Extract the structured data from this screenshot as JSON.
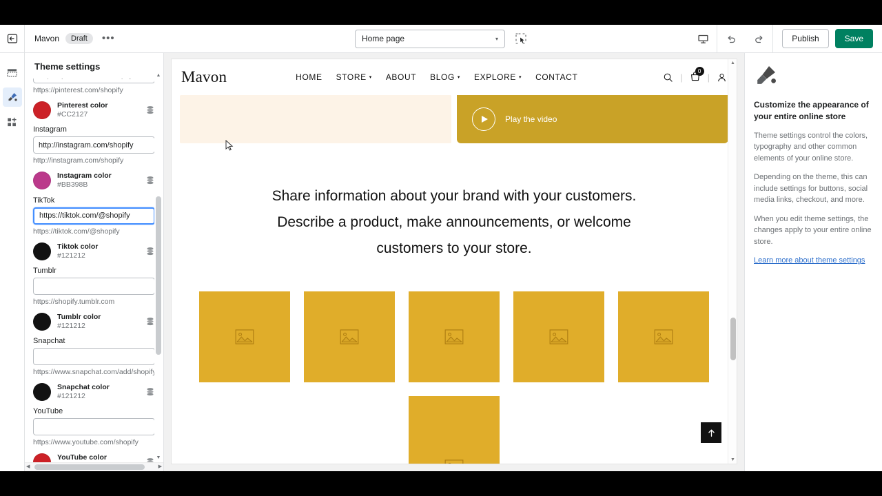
{
  "topbar": {
    "exit_icon": "exit-icon",
    "theme_name": "Mavon",
    "status_badge": "Draft",
    "more_label": "•••",
    "page_selector_value": "Home page",
    "caret": "▾",
    "inspect_icon": "inspector-tool-icon",
    "device_icon": "desktop-icon",
    "undo_icon": "undo-icon",
    "redo_icon": "redo-icon",
    "publish_label": "Publish",
    "save_label": "Save",
    "save_color": "#008060"
  },
  "rail": {
    "items": [
      {
        "name": "sections-icon",
        "label": "Sections",
        "active": false
      },
      {
        "name": "theme-settings-brush-icon",
        "label": "Theme settings",
        "active": true
      },
      {
        "name": "app-blocks-icon",
        "label": "App blocks",
        "active": false
      }
    ]
  },
  "sidebar": {
    "title": "Theme settings",
    "fields": [
      {
        "label": "",
        "value": "https://pinterest.com/shopify",
        "help": "https://pinterest.com/shopify",
        "focused": false,
        "clipped": true
      },
      {
        "label": "Instagram",
        "value": "http://instagram.com/shopify",
        "help": "http://instagram.com/shopify",
        "focused": false,
        "clipped": false
      },
      {
        "label": "TikTok",
        "value": "https://tiktok.com/@shopify",
        "help": "https://tiktok.com/@shopify",
        "focused": true,
        "clipped": false
      },
      {
        "label": "Tumblr",
        "value": "",
        "help": "https://shopify.tumblr.com",
        "focused": false,
        "clipped": false
      },
      {
        "label": "Snapchat",
        "value": "",
        "help": "https://www.snapchat.com/add/shopify",
        "focused": false,
        "clipped": false
      },
      {
        "label": "YouTube",
        "value": "",
        "help": "https://www.youtube.com/shopify",
        "focused": false,
        "clipped": false
      }
    ],
    "colors": [
      {
        "name": "Pinterest color",
        "hex": "#CC2127",
        "after_field": 0
      },
      {
        "name": "Instagram color",
        "hex": "#BB398B",
        "after_field": 1
      },
      {
        "name": "Tiktok color",
        "hex": "#121212",
        "after_field": 2
      },
      {
        "name": "Tumblr color",
        "hex": "#121212",
        "after_field": 3
      },
      {
        "name": "Snapchat color",
        "hex": "#121212",
        "after_field": 4
      },
      {
        "name": "YouTube color",
        "hex": "#CC2127",
        "after_field": 5
      }
    ],
    "reset_icon": "database-swatch-icon"
  },
  "preview": {
    "store": {
      "brand": "Mavon",
      "nav": [
        {
          "label": "HOME",
          "has_caret": false
        },
        {
          "label": "STORE",
          "has_caret": true
        },
        {
          "label": "ABOUT",
          "has_caret": false
        },
        {
          "label": "BLOG",
          "has_caret": true
        },
        {
          "label": "EXPLORE",
          "has_caret": true
        },
        {
          "label": "CONTACT",
          "has_caret": false
        }
      ],
      "search_icon": "search-icon",
      "cart_icon": "cart-icon",
      "cart_count": "0",
      "account_icon": "account-icon",
      "separator": "|"
    },
    "hero": {
      "left_bg": "#fdf3e7",
      "right_bg": "#c9a227",
      "play_label": "Play the video",
      "play_icon": "play-circle-icon"
    },
    "rich_text": {
      "line1": "Share information about your brand with your customers.",
      "line2": "Describe a product, make announcements, or welcome",
      "line3": "customers to your store."
    },
    "tiles": {
      "count_row1": 5,
      "count_row2": 1,
      "color": "#e0ad2a",
      "placeholder_icon": "image-placeholder-icon"
    },
    "scroll_top_icon": "arrow-up-icon",
    "scroll_top_bg": "#121212",
    "cursor_icon": "mouse-cursor"
  },
  "rightpanel": {
    "icon": "paintbrush-icon",
    "title": "Customize the appearance of your entire online store",
    "paragraphs": [
      "Theme settings control the colors, typography and other common elements of your online store.",
      "Depending on the theme, this can include settings for buttons, social media links, checkout, and more.",
      "When you edit theme settings, the changes apply to your entire online store."
    ],
    "link": "Learn more about theme settings",
    "link_color": "#2c6ecb"
  }
}
